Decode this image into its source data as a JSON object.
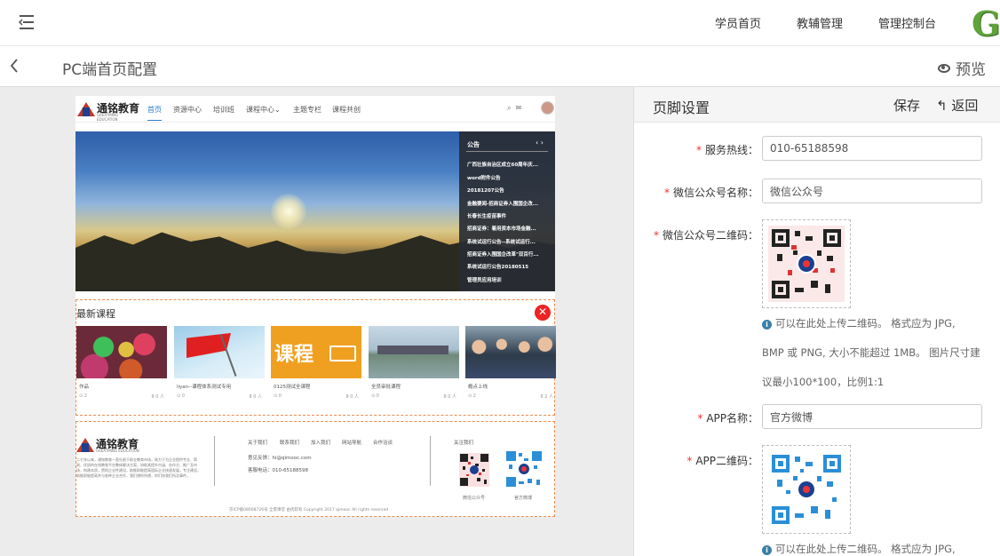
{
  "topbar": {
    "nav": [
      "学员首页",
      "教辅管理",
      "管理控制台"
    ],
    "logo": "G"
  },
  "titlebar": {
    "back": "<",
    "title": "PC端首页配置",
    "preview": "预览"
  },
  "site_preview": {
    "brand": "通铭教育",
    "brand_sub": "GREATMING EDUCATION",
    "nav": [
      "首页",
      "资源中心",
      "培训班",
      "课程中心",
      "主题专栏",
      "课程共创"
    ],
    "notice": {
      "title": "公告",
      "items": [
        "广西壮族自治区成立60周年庆...",
        "word附件公告",
        "20181207公告",
        "金融要闻-招商证券入围国企改...",
        "长春长生疫苗事件",
        "招商证券：着用资本市场金融...",
        "系统试运行公告--系统试运行...",
        "招商证券入围国企改革\"双百行...",
        "系统试运行公告20180515",
        "管理员应用培训"
      ]
    },
    "courses": {
      "title": "最新课程",
      "items": [
        {
          "name": "作品",
          "stats": "⊙ 2",
          "users": "8 0 人"
        },
        {
          "name": "liyan--课程体系测试专用",
          "stats": "⊙ 0",
          "users": "8 0 人"
        },
        {
          "name": "0125测试全课程",
          "stats": "⊙ 0",
          "users": "8 0 人"
        },
        {
          "name": "全员审批课程",
          "stats": "⊙ 0",
          "users": "8 0 人"
        },
        {
          "name": "概点上线",
          "stats": "⊙ 2",
          "users": "8 2 人"
        }
      ]
    },
    "footer": {
      "text": "二七年以来，通铭教育一直扎根于职业教育市场，致力于为企业提供专业、简易、优质的在线教育平台整体解决方案，协助其提升内涵、办作方、推广及市场，构建本质，贯彻企业性建设，助推职能提高国际企业快速发展，专注建设，助推职能提高并与各种企业合作，我们想你所想，你们快我们所及事件。",
      "links": [
        "关于我们",
        "联系我们",
        "加入我们",
        "网站导航",
        "合作洽谈"
      ],
      "feedback": "意见反馈：hi@qimooc.com",
      "phone": "客服电话：010-65188598",
      "follow": "关注我们",
      "qr_labels": [
        "微信公众号",
        "官方微博"
      ],
      "copyright": "京ICP备08008726号 全景课堂 由优软有 Copyright 2017 qimooc All rights reserved"
    }
  },
  "footer_settings": {
    "title": "页脚设置",
    "save": "保存",
    "return": "返回",
    "fields": {
      "hotline": {
        "label": "服务热线：",
        "value": "010-65188598"
      },
      "wechat_name": {
        "label": "微信公众号名称：",
        "value": "微信公众号"
      },
      "wechat_qr": {
        "label": "微信公众号二维码："
      },
      "app_name": {
        "label": "APP名称：",
        "value": "官方微博"
      },
      "app_qr": {
        "label": "APP二维码："
      }
    },
    "hint_lines": [
      "可以在此处上传二维码。 格式应为 JPG,",
      "BMP 或 PNG, 大小不能超过 1MB。 图片尺寸建",
      "议最小100*100，比例1:1"
    ],
    "hint2_line": "可以在此处上传二维码。 格式应为 JPG,"
  },
  "colors": {
    "accent": "#2f7ccd",
    "required": "#e33333",
    "dashed": "#f08a4b"
  }
}
